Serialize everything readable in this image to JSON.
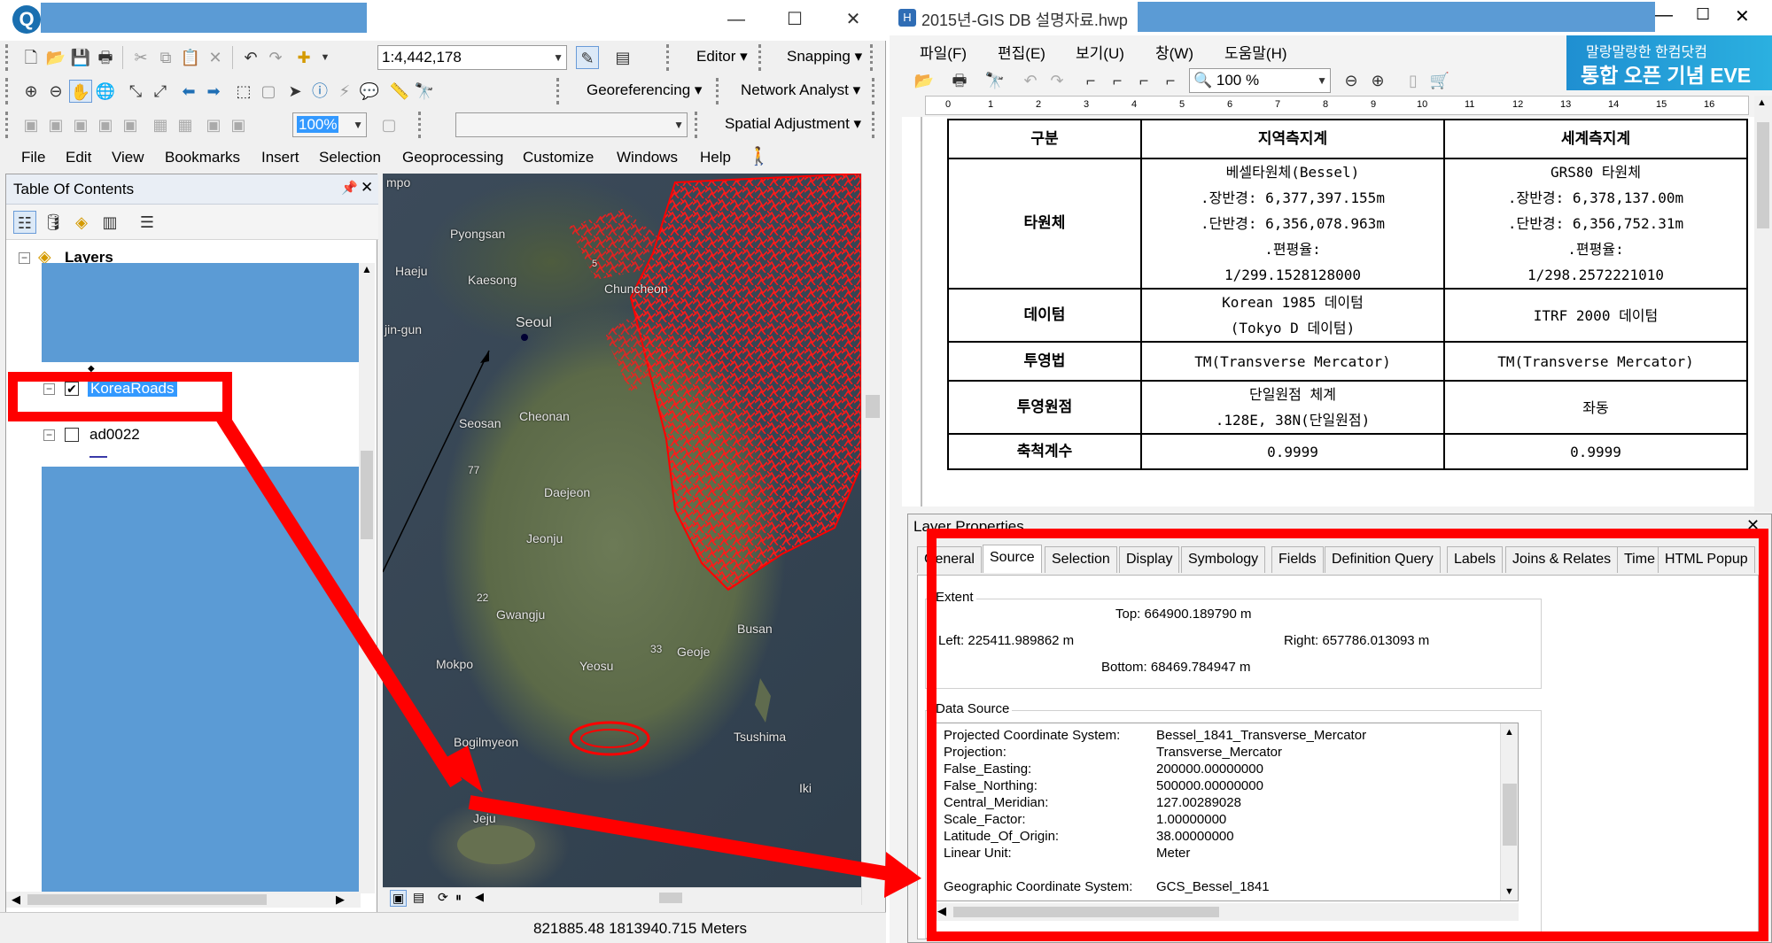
{
  "arcmap": {
    "toolbar": {
      "scale": "1:4,442,178",
      "editor_label": "Editor",
      "snapping_label": "Snapping",
      "georef_label": "Georeferencing",
      "network_label": "Network Analyst",
      "spatial_label": "Spatial Adjustment",
      "zoom_value": "100%"
    },
    "menu": [
      "File",
      "Edit",
      "View",
      "Bookmarks",
      "Insert",
      "Selection",
      "Geoprocessing",
      "Customize",
      "Windows",
      "Help"
    ],
    "toc": {
      "title": "Table Of Contents",
      "root": "Layers",
      "layers": [
        {
          "name": "KoreaRoads",
          "checked": true,
          "selected": true
        },
        {
          "name": "ad0022",
          "checked": false,
          "selected": false
        }
      ]
    },
    "map": {
      "labels": [
        "mpo",
        "Pyongsan",
        "Haeju",
        "Kaesong",
        "jin-gun",
        "Seoul",
        "Chuncheon",
        "Seosan",
        "Cheonan",
        "77",
        "Daejeon",
        "Jeonju",
        "22",
        "Gwangju",
        "Mokpo",
        "Yeosu",
        "33",
        "Geoje",
        "Busan",
        "Tsushima",
        "Iki",
        "Bogilmyeon",
        "Jeju",
        "5"
      ]
    },
    "status": "821885.48  1813940.715 Meters"
  },
  "hwp": {
    "title": "2015년-GIS DB 설명자료.hwp",
    "menu": [
      "파일(F)",
      "편집(E)",
      "보기(U)",
      "창(W)",
      "도움말(H)"
    ],
    "banner_line1": "말랑말랑한 한컴닷컴",
    "banner_line2": "통합 오픈 기념 EVE",
    "zoom": "100 %",
    "ruler": [
      "0",
      "1",
      "2",
      "3",
      "4",
      "5",
      "6",
      "7",
      "8",
      "9",
      "10",
      "11",
      "12",
      "13",
      "14",
      "15",
      "16"
    ],
    "table": {
      "headers": [
        "구분",
        "지역측지계",
        "세계측지계"
      ],
      "rows": [
        {
          "label": "타원체",
          "local": [
            "베셀타원체(Bessel)",
            ".장반경: 6,377,397.155m",
            ".단반경: 6,356,078.963m",
            ".편평율:",
            "1/299.1528128000"
          ],
          "world": [
            "GRS80 타원체",
            ".장반경: 6,378,137.00m",
            ".단반경: 6,356,752.31m",
            ".편평율:",
            "1/298.2572221010"
          ]
        },
        {
          "label": "데이텀",
          "local": [
            "Korean 1985 데이텀",
            "(Tokyo D 데이텀)"
          ],
          "world": [
            "ITRF 2000 데이텀"
          ]
        },
        {
          "label": "투영법",
          "local": [
            "TM(Transverse Mercator)"
          ],
          "world": [
            "TM(Transverse Mercator)"
          ]
        },
        {
          "label": "투영원점",
          "local": [
            "단일원점 체계",
            ".128E, 38N(단일원점)"
          ],
          "world": [
            "좌동"
          ]
        },
        {
          "label": "축척계수",
          "local": [
            "0.9999"
          ],
          "world": [
            "0.9999"
          ]
        }
      ]
    }
  },
  "layer_props": {
    "title": "Layer Properties",
    "tabs": [
      "General",
      "Source",
      "Selection",
      "Display",
      "Symbology",
      "Fields",
      "Definition Query",
      "Labels",
      "Joins & Relates",
      "Time",
      "HTML Popup"
    ],
    "active_tab": "Source",
    "extent": {
      "group": "Extent",
      "top": "Top:  664900.189790 m",
      "left": "Left: 225411.989862 m",
      "right": "Right:  657786.013093 m",
      "bottom": "Bottom:  68469.784947 m"
    },
    "data_source": {
      "group": "Data Source",
      "rows": [
        {
          "k": "Projected Coordinate System:",
          "v": "Bessel_1841_Transverse_Mercator"
        },
        {
          "k": "Projection:",
          "v": "Transverse_Mercator"
        },
        {
          "k": "False_Easting:",
          "v": "200000.00000000"
        },
        {
          "k": "False_Northing:",
          "v": "500000.00000000"
        },
        {
          "k": "Central_Meridian:",
          "v": "127.00289028"
        },
        {
          "k": "Scale_Factor:",
          "v": "1.00000000"
        },
        {
          "k": "Latitude_Of_Origin:",
          "v": "38.00000000"
        },
        {
          "k": "Linear Unit:",
          "v": "Meter"
        },
        {
          "k": "",
          "v": ""
        },
        {
          "k": "Geographic Coordinate System:",
          "v": "GCS_Bessel_1841"
        }
      ]
    }
  },
  "colors": {
    "highlight": "#ff0000",
    "redaction": "#5b9bd5",
    "selection": "#3399ff"
  }
}
